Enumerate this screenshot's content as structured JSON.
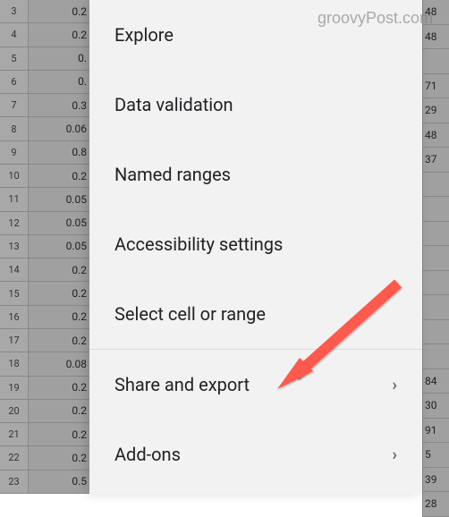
{
  "watermark": "groovyPost.com",
  "spreadsheet": {
    "row_numbers": [
      "3",
      "4",
      "5",
      "6",
      "7",
      "8",
      "9",
      "10",
      "11",
      "12",
      "13",
      "14",
      "15",
      "16",
      "17",
      "18",
      "19",
      "20",
      "21",
      "22",
      "23"
    ],
    "left_cells": [
      "0.2",
      "0.2",
      "0.",
      "0.",
      "0.3",
      "0.06",
      "0.8",
      "0.2",
      "0.05",
      "0.05",
      "0.05",
      "0.2",
      "0.2",
      "0.2",
      "0.2",
      "0.08",
      "0.2",
      "0.2",
      "0.2",
      "0.2",
      "0.5"
    ],
    "right_cells": [
      "48",
      "48",
      "",
      "71",
      "29",
      "48",
      "37",
      "",
      "",
      "",
      "",
      "",
      "",
      "",
      "",
      "84",
      "30",
      "91",
      "5",
      "39",
      "28"
    ]
  },
  "menu": {
    "items": [
      {
        "label": "Explore",
        "has_chevron": false
      },
      {
        "label": "Data validation",
        "has_chevron": false
      },
      {
        "label": "Named ranges",
        "has_chevron": false
      },
      {
        "label": "Accessibility settings",
        "has_chevron": false
      },
      {
        "label": "Select cell or range",
        "has_chevron": false
      },
      {
        "label": "Share and export",
        "has_chevron": true
      },
      {
        "label": "Add-ons",
        "has_chevron": true
      }
    ]
  }
}
